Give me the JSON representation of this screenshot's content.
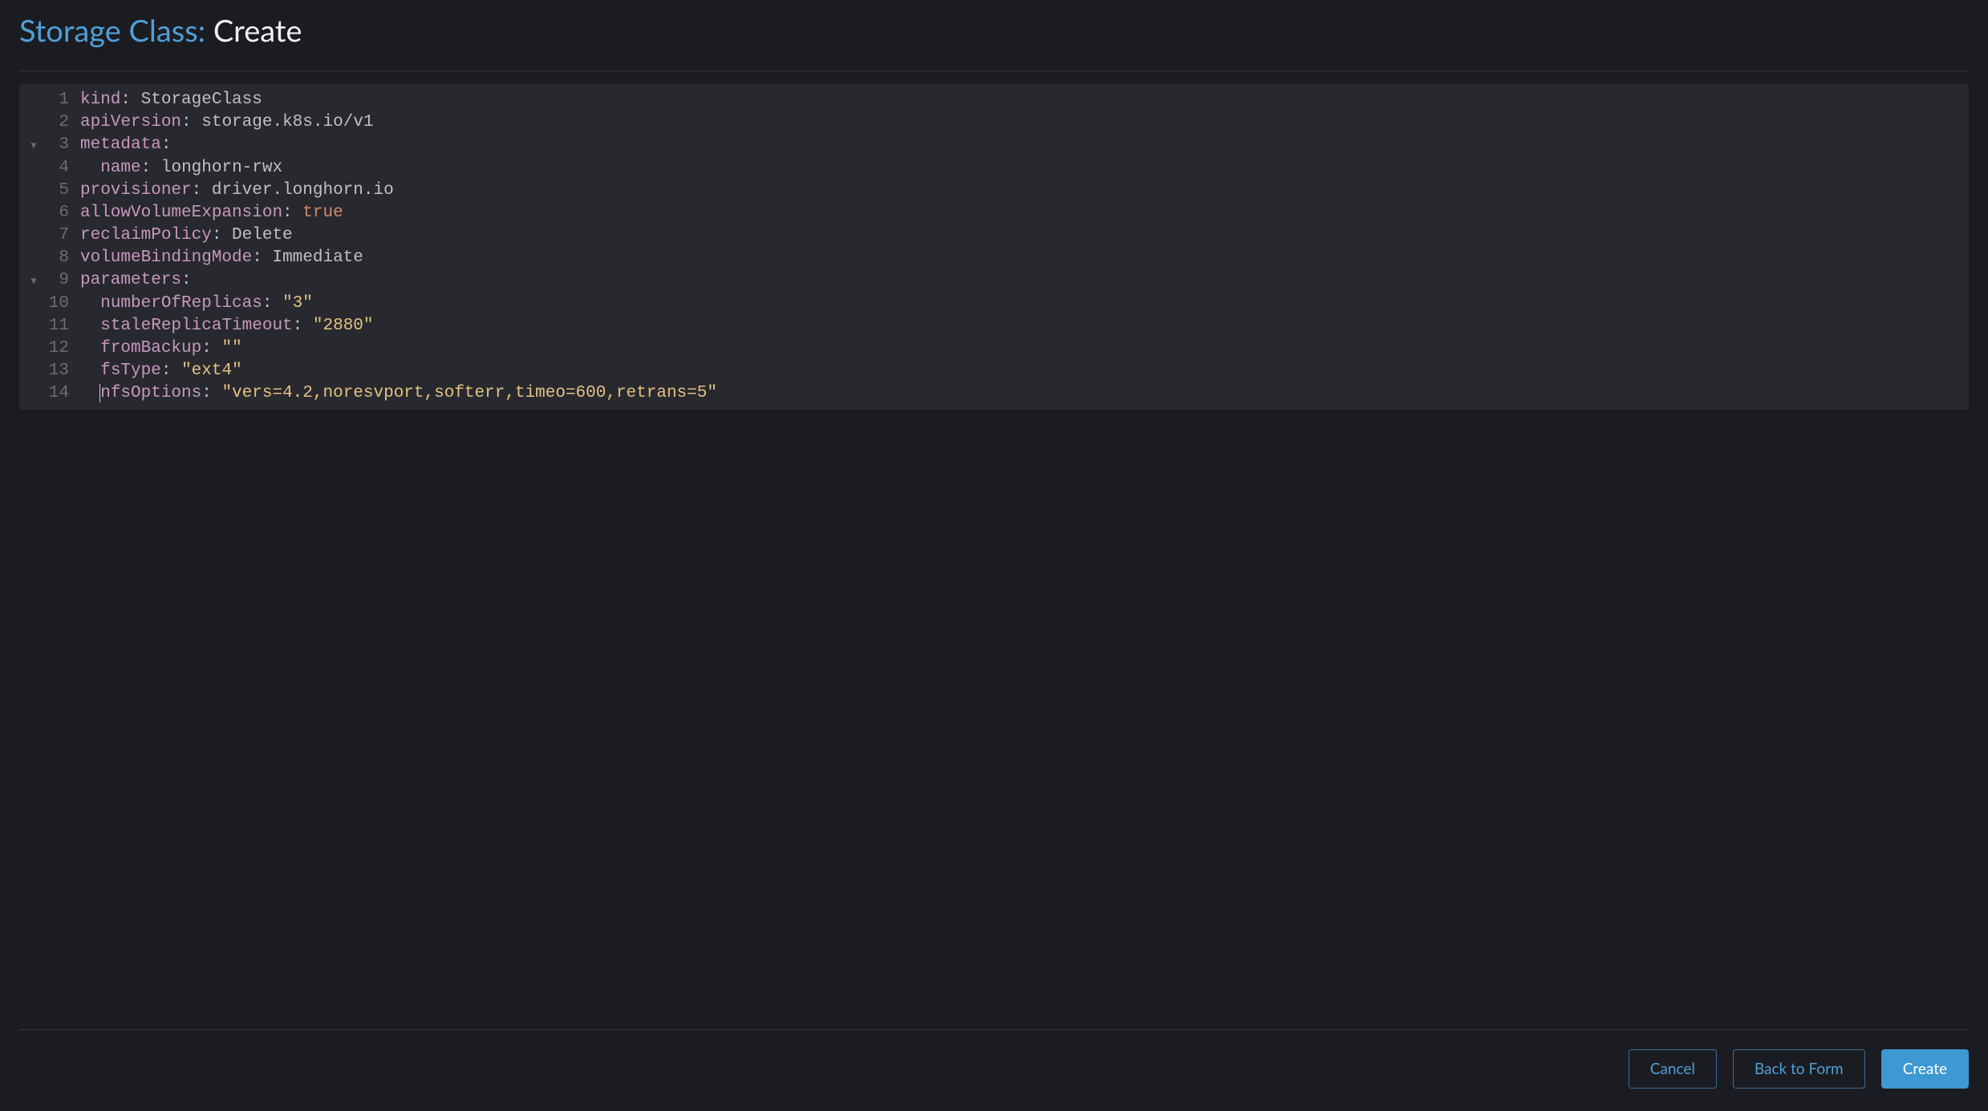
{
  "header": {
    "title_prefix": "Storage Class: ",
    "title_suffix": "Create"
  },
  "editor": {
    "fold_glyph": "▼",
    "lines": [
      {
        "num": "1",
        "fold": false,
        "tokens": [
          {
            "t": "key",
            "v": "kind"
          },
          {
            "t": "colon",
            "v": ": "
          },
          {
            "t": "plain",
            "v": "StorageClass"
          }
        ]
      },
      {
        "num": "2",
        "fold": false,
        "tokens": [
          {
            "t": "key",
            "v": "apiVersion"
          },
          {
            "t": "colon",
            "v": ": "
          },
          {
            "t": "plain",
            "v": "storage.k8s.io/v1"
          }
        ]
      },
      {
        "num": "3",
        "fold": true,
        "tokens": [
          {
            "t": "key",
            "v": "metadata"
          },
          {
            "t": "colon",
            "v": ":"
          }
        ]
      },
      {
        "num": "4",
        "fold": false,
        "tokens": [
          {
            "t": "plain",
            "v": "  "
          },
          {
            "t": "key",
            "v": "name"
          },
          {
            "t": "colon",
            "v": ": "
          },
          {
            "t": "plain",
            "v": "longhorn-rwx"
          }
        ]
      },
      {
        "num": "5",
        "fold": false,
        "tokens": [
          {
            "t": "key",
            "v": "provisioner"
          },
          {
            "t": "colon",
            "v": ": "
          },
          {
            "t": "plain",
            "v": "driver.longhorn.io"
          }
        ]
      },
      {
        "num": "6",
        "fold": false,
        "tokens": [
          {
            "t": "key",
            "v": "allowVolumeExpansion"
          },
          {
            "t": "colon",
            "v": ": "
          },
          {
            "t": "const",
            "v": "true"
          }
        ]
      },
      {
        "num": "7",
        "fold": false,
        "tokens": [
          {
            "t": "key",
            "v": "reclaimPolicy"
          },
          {
            "t": "colon",
            "v": ": "
          },
          {
            "t": "plain",
            "v": "Delete"
          }
        ]
      },
      {
        "num": "8",
        "fold": false,
        "tokens": [
          {
            "t": "key",
            "v": "volumeBindingMode"
          },
          {
            "t": "colon",
            "v": ": "
          },
          {
            "t": "plain",
            "v": "Immediate"
          }
        ]
      },
      {
        "num": "9",
        "fold": true,
        "tokens": [
          {
            "t": "key",
            "v": "parameters"
          },
          {
            "t": "colon",
            "v": ":"
          }
        ]
      },
      {
        "num": "10",
        "fold": false,
        "tokens": [
          {
            "t": "plain",
            "v": "  "
          },
          {
            "t": "key",
            "v": "numberOfReplicas"
          },
          {
            "t": "colon",
            "v": ": "
          },
          {
            "t": "str",
            "v": "\"3\""
          }
        ]
      },
      {
        "num": "11",
        "fold": false,
        "tokens": [
          {
            "t": "plain",
            "v": "  "
          },
          {
            "t": "key",
            "v": "staleReplicaTimeout"
          },
          {
            "t": "colon",
            "v": ": "
          },
          {
            "t": "str",
            "v": "\"2880\""
          }
        ]
      },
      {
        "num": "12",
        "fold": false,
        "tokens": [
          {
            "t": "plain",
            "v": "  "
          },
          {
            "t": "key",
            "v": "fromBackup"
          },
          {
            "t": "colon",
            "v": ": "
          },
          {
            "t": "str",
            "v": "\"\""
          }
        ]
      },
      {
        "num": "13",
        "fold": false,
        "tokens": [
          {
            "t": "plain",
            "v": "  "
          },
          {
            "t": "key",
            "v": "fsType"
          },
          {
            "t": "colon",
            "v": ": "
          },
          {
            "t": "str",
            "v": "\"ext4\""
          }
        ]
      },
      {
        "num": "14",
        "fold": false,
        "cursor": true,
        "tokens": [
          {
            "t": "plain",
            "v": "  "
          },
          {
            "t": "key",
            "v": "nfsOptions"
          },
          {
            "t": "colon",
            "v": ": "
          },
          {
            "t": "str",
            "v": "\"vers=4.2,noresvport,softerr,timeo=600,retrans=5\""
          }
        ]
      }
    ]
  },
  "footer": {
    "cancel": "Cancel",
    "back": "Back to Form",
    "create": "Create"
  }
}
